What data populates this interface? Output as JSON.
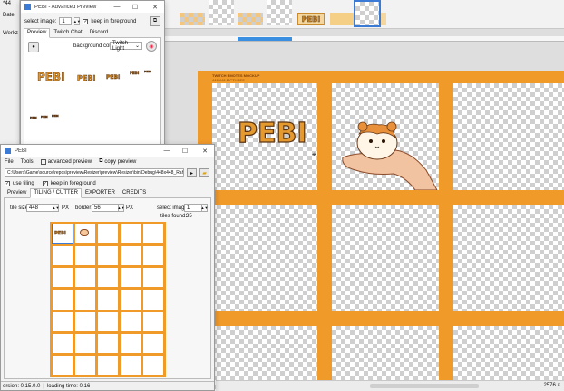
{
  "host": {
    "tab_fragment": "*44",
    "menu_fragment": "Date",
    "side_fragment": "Werkz",
    "status_zoom": "2576 ×",
    "thumbnails_count": 9
  },
  "canvas": {
    "banner_line1": "TWITCH EMOTES MOCKUP",
    "banner_line2": "448/448 PICTURES",
    "logo_text": "PEBI",
    "colors": {
      "border": "#f09a2a"
    }
  },
  "preview_window": {
    "title": "PEBI - Advanced Preview",
    "select_image_label": "select image:",
    "select_image_value": "1",
    "keep_foreground_label": "keep in foreground",
    "tabs": [
      "Preview",
      "Twitch Chat",
      "Discord"
    ],
    "background_label": "background color:",
    "background_value": "Twitch Light",
    "emote_text": "PEBI"
  },
  "main_window": {
    "title": "PEBI",
    "menu": {
      "file": "File",
      "tools": "Tools",
      "advanced_preview": "advanced preview",
      "copy_preview": "copy preview"
    },
    "path": "C:\\Users\\Game\\source\\repos\\preview\\Resizer\\preview\\Resizer\\bin\\Debug\\448x448_Rahmen_Em",
    "use_tiling_label": "use tiling",
    "keep_foreground_label": "keep in foreground",
    "tabs": [
      "Preview",
      "TILING / CUTTER",
      "EXPORTER",
      "CREDITS"
    ],
    "tile_size_label": "tile size:",
    "tile_size_value": "448",
    "px_label": "PX",
    "border_label": "border:",
    "border_value": "56",
    "select_image_label": "select image:",
    "select_image_value": "1",
    "tiles_found_label": "tiles found:",
    "tiles_found_value": "35",
    "status_version": "ersion: 0.15.0.0",
    "status_loading": "loading time: 0.16"
  }
}
